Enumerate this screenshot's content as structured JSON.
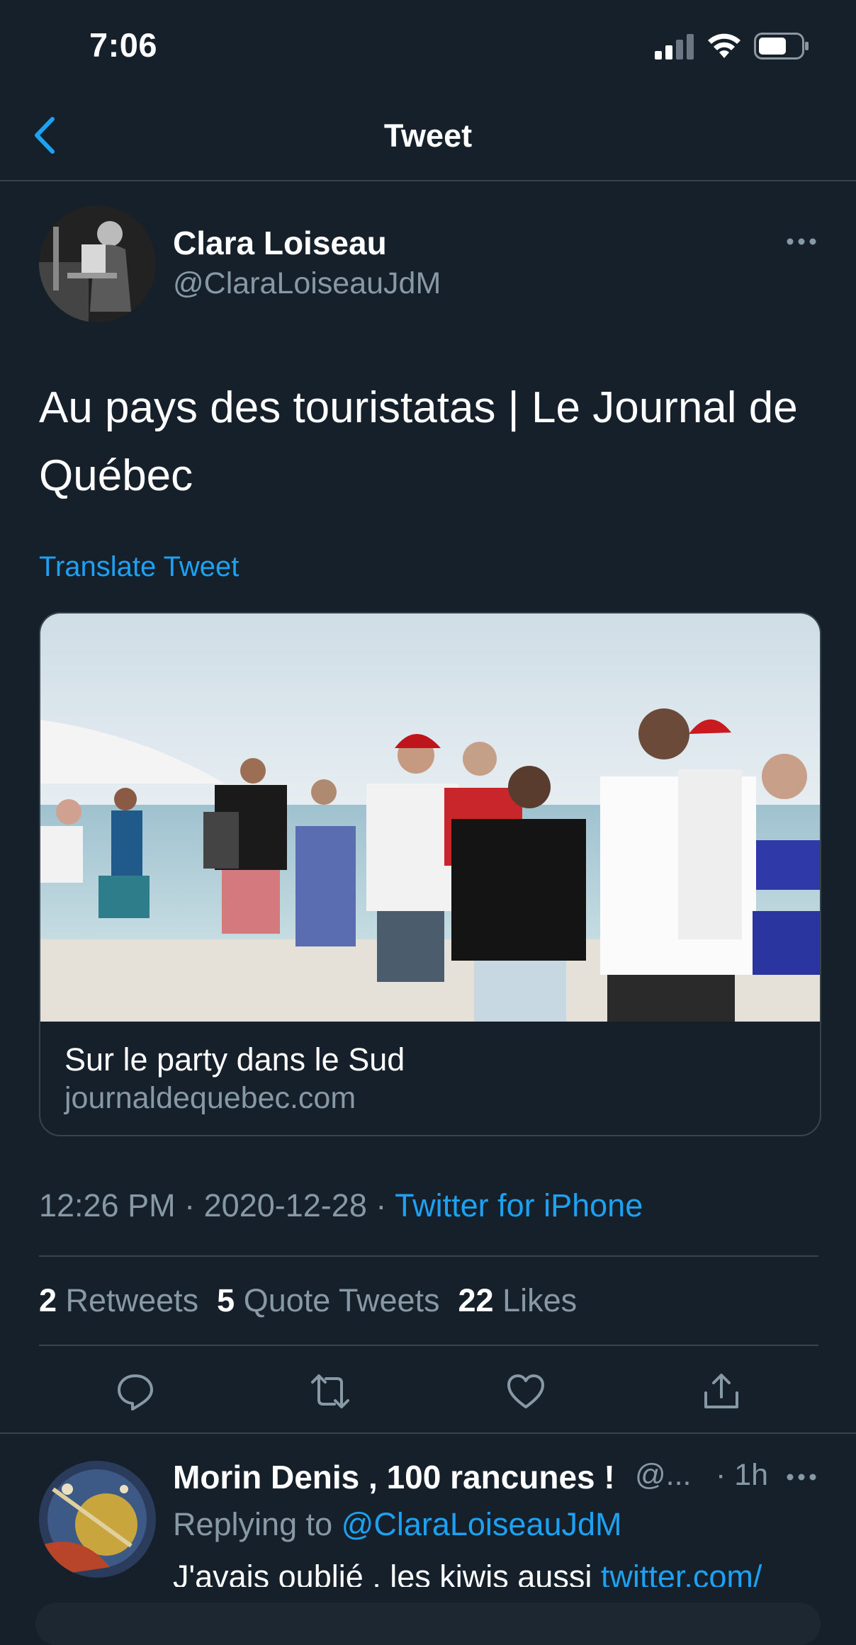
{
  "status_bar": {
    "time": "7:06",
    "icons": [
      "signal-icon",
      "wifi-icon",
      "battery-icon"
    ]
  },
  "nav": {
    "title": "Tweet",
    "back_icon": "chevron-left-icon"
  },
  "tweet": {
    "author_name": "Clara Loiseau",
    "author_handle": "@ClaraLoiseauJdM",
    "text": "Au pays des touristatas | Le Journal de Québec",
    "translate": "Translate Tweet",
    "card": {
      "title": "Sur le party dans le Sud",
      "domain": "journaldequebec.com"
    },
    "time": "12:26 PM",
    "dot": "·",
    "date": "2020-12-28",
    "source": "Twitter for iPhone",
    "retweets_count": "2",
    "retweets_label": "Retweets",
    "quotes_count": "5",
    "quotes_label": "Quote Tweets",
    "likes_count": "22",
    "likes_label": "Likes"
  },
  "actions": [
    "reply-icon",
    "retweet-icon",
    "like-icon",
    "share-icon"
  ],
  "reply": {
    "author_name": "Morin Denis , 100 rancunes !",
    "author_handle": "@...",
    "time": "· 1h",
    "replying_prefix": "Replying to",
    "replying_to": "@ClaraLoiseauJdM",
    "text": "J'avais oublié , les kiwis aussi",
    "link": "twitter.com/"
  },
  "colors": {
    "background": "#15202b",
    "accent": "#1da1f2",
    "muted": "#8899a6",
    "border": "#38444d"
  }
}
